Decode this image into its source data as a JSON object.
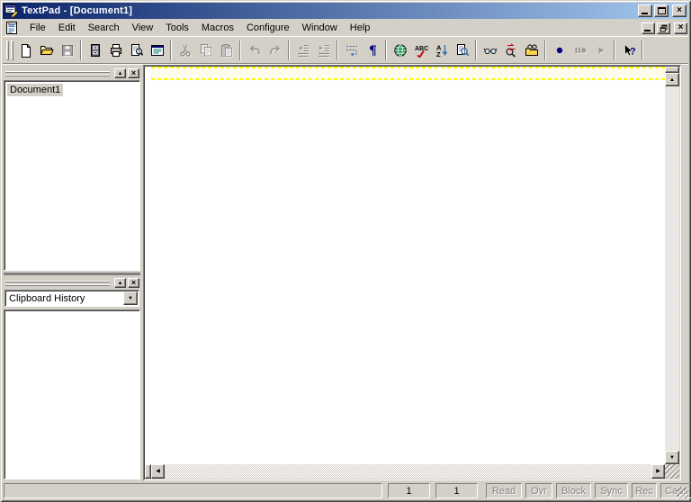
{
  "window": {
    "title": "TextPad - [Document1]"
  },
  "menu": {
    "items": [
      "File",
      "Edit",
      "Search",
      "View",
      "Tools",
      "Macros",
      "Configure",
      "Window",
      "Help"
    ]
  },
  "toolbar": {
    "groups": [
      {
        "buttons": [
          {
            "name": "new-document",
            "disabled": false
          },
          {
            "name": "open-file",
            "disabled": false
          },
          {
            "name": "save-file",
            "disabled": true
          }
        ]
      },
      {
        "buttons": [
          {
            "name": "manage-files",
            "disabled": false
          },
          {
            "name": "print",
            "disabled": false
          },
          {
            "name": "print-preview",
            "disabled": false
          },
          {
            "name": "full-screen",
            "disabled": false
          }
        ]
      },
      {
        "buttons": [
          {
            "name": "cut",
            "disabled": true
          },
          {
            "name": "copy",
            "disabled": true
          },
          {
            "name": "paste",
            "disabled": true
          }
        ]
      },
      {
        "buttons": [
          {
            "name": "undo",
            "disabled": true
          },
          {
            "name": "redo",
            "disabled": true
          }
        ]
      },
      {
        "buttons": [
          {
            "name": "unindent",
            "disabled": true
          },
          {
            "name": "indent",
            "disabled": true
          }
        ]
      },
      {
        "buttons": [
          {
            "name": "word-wrap",
            "disabled": false
          },
          {
            "name": "visible-whitespace",
            "disabled": false
          }
        ]
      },
      {
        "buttons": [
          {
            "name": "view-in-browser",
            "disabled": false
          },
          {
            "name": "spell-check",
            "disabled": false
          },
          {
            "name": "sort",
            "disabled": false
          },
          {
            "name": "compare-files",
            "disabled": false
          }
        ]
      },
      {
        "buttons": [
          {
            "name": "find",
            "disabled": false
          },
          {
            "name": "replace",
            "disabled": false
          },
          {
            "name": "find-in-files",
            "disabled": false
          }
        ]
      },
      {
        "buttons": [
          {
            "name": "record-macro",
            "disabled": false
          },
          {
            "name": "pause-macro",
            "disabled": true
          },
          {
            "name": "play-macro",
            "disabled": true
          }
        ]
      },
      {
        "buttons": [
          {
            "name": "context-help",
            "disabled": false
          }
        ]
      }
    ]
  },
  "panels": {
    "document_selector": {
      "items": [
        {
          "label": "Document1",
          "selected": true
        }
      ]
    },
    "clipboard": {
      "selected_option": "Clipboard History"
    }
  },
  "editor": {
    "content": ""
  },
  "statusbar": {
    "message": "",
    "line": "1",
    "column": "1",
    "indicators": [
      "Read",
      "Ovr",
      "Block",
      "Sync",
      "Rec",
      "Caps"
    ]
  },
  "icons": {
    "close_glyph": "×",
    "up_arrow_glyph": "▲",
    "down_arrow_glyph": "▼",
    "left_arrow_glyph": "◀",
    "right_arrow_glyph": "▶",
    "collapse_arrow_glyph": "▲",
    "dropdown_arrow_glyph": "▼"
  },
  "colors": {
    "window_face": "#d4d0c8",
    "titlebar_gradient_start": "#0a246a",
    "titlebar_gradient_end": "#a6caf0",
    "editor_background": "#ffffff",
    "current_line_background": "#fdfbec",
    "current_line_dash": "#ffff00",
    "disabled_text": "#848284",
    "selection_background": "#d4d0c8"
  }
}
